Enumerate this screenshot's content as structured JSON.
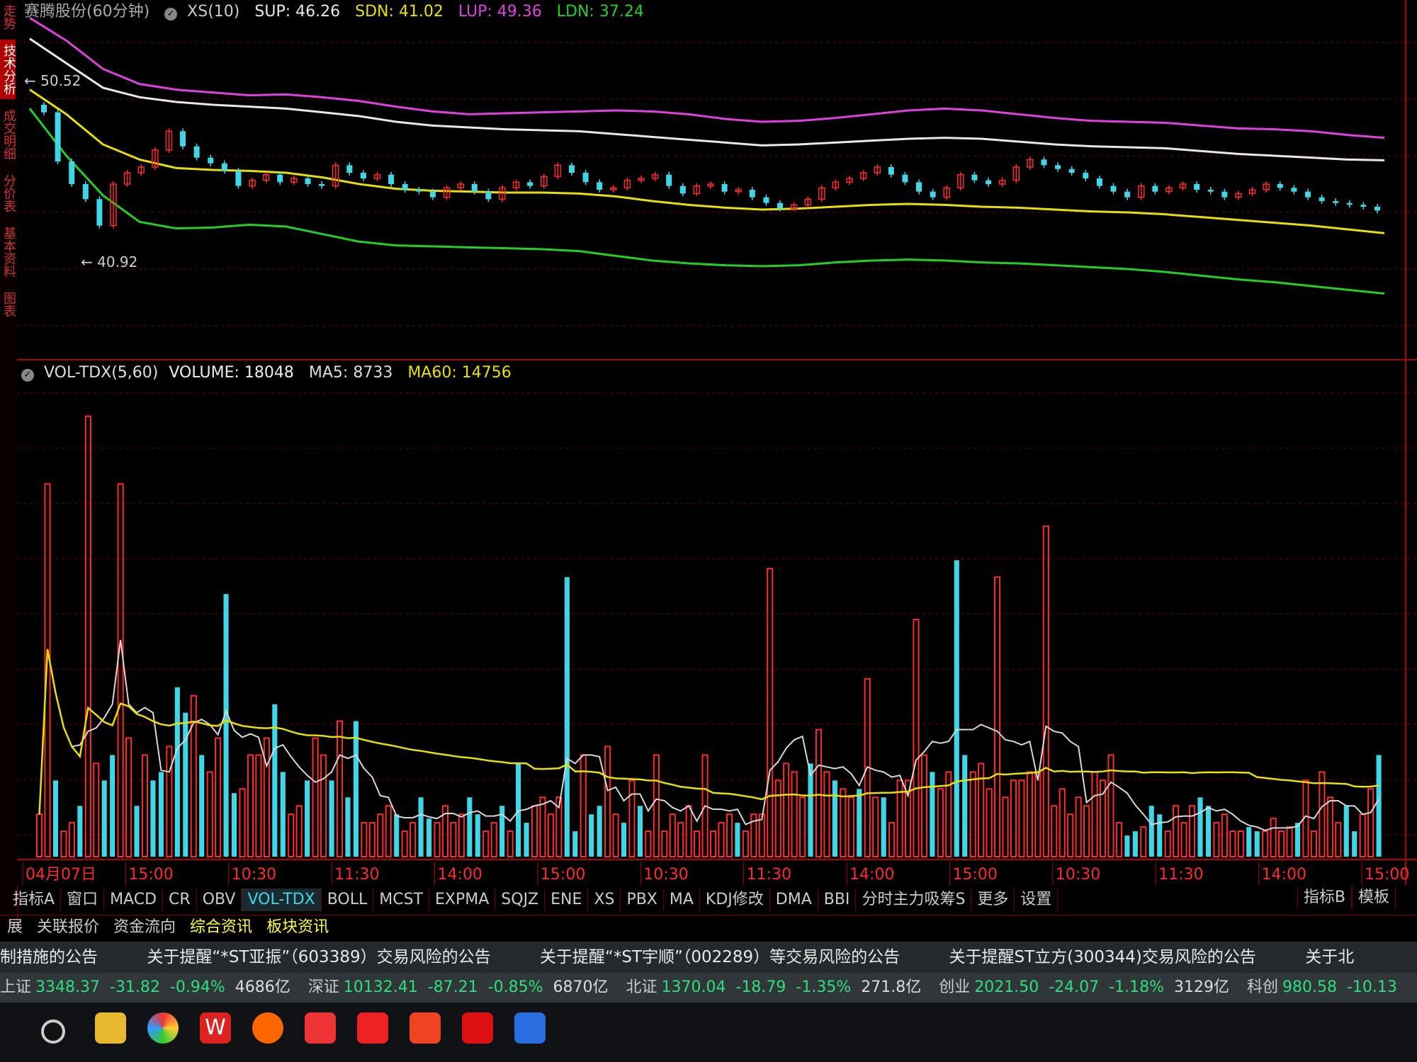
{
  "sidebar": {
    "items": [
      "走势",
      "技术分析",
      "成交明细",
      "分价表",
      "基本资料",
      "图表"
    ]
  },
  "main_legend": {
    "stock": "赛腾股份(60分钟)",
    "indicator": "XS(10)",
    "sup": "SUP: 46.26",
    "sdn": "SDN: 41.02",
    "lup": "LUP: 49.36",
    "ldn": "LDN: 37.24"
  },
  "price_labels": {
    "high": "50.52",
    "low": "40.92"
  },
  "volume_legend": {
    "name": "VOL-TDX(5,60)",
    "volume": "VOLUME: 18048",
    "ma5": "MA5: 8733",
    "ma60": "MA60: 14756"
  },
  "time_axis": [
    "04月07日",
    "15:00",
    "10:30",
    "11:30",
    "14:00",
    "15:00",
    "10:30",
    "11:30",
    "14:00",
    "15:00",
    "10:30",
    "11:30",
    "14:00",
    "15:00"
  ],
  "indicator_tabs": [
    "指标A",
    "窗口",
    "MACD",
    "CR",
    "OBV",
    "VOL-TDX",
    "BOLL",
    "MCST",
    "EXPMA",
    "SQJZ",
    "ENE",
    "XS",
    "PBX",
    "MA",
    "KDJ修改",
    "DMA",
    "BBI",
    "分时主力吸筹S",
    "更多",
    "设置"
  ],
  "right_tabs": [
    "指标B",
    "模板"
  ],
  "info_tabs": [
    "展",
    "关联报价",
    "资金流向",
    "综合资讯",
    "板块资讯"
  ],
  "news": [
    "制措施的公告",
    "关于提醒“*ST亚振”（603389）交易风险的公告",
    "关于提醒“*ST宇顺”（002289）等交易风险的公告",
    "关于提醒ST立方(300344)交易风险的公告",
    "关于北"
  ],
  "indices": [
    {
      "name": "上证",
      "value": "3348.37",
      "change": "-31.82",
      "pct": "-0.94%",
      "amount": "4686亿"
    },
    {
      "name": "深证",
      "value": "10132.41",
      "change": "-87.21",
      "pct": "-0.85%",
      "amount": "6870亿"
    },
    {
      "name": "北证",
      "value": "1370.04",
      "change": "-18.79",
      "pct": "-1.35%",
      "amount": "271.8亿"
    },
    {
      "name": "创业",
      "value": "2021.50",
      "change": "-24.07",
      "pct": "-1.18%",
      "amount": "3129亿"
    },
    {
      "name": "科创",
      "value": "980.58",
      "change": "-10.13",
      "pct": "",
      "amount": ""
    }
  ],
  "colors": {
    "up": "#ff2a2a",
    "down": "#3fd7e8",
    "lup": "#e040e0",
    "sup": "#e8e8e8",
    "sdn": "#e8e000",
    "ldn": "#22d022",
    "ma5": "#d8d8d8",
    "ma60": "#e8e000",
    "grid": "#7a0000"
  },
  "chart_data": [
    {
      "type": "candlestick",
      "title": "赛腾股份(60分钟)",
      "ylim": [
        36,
        54
      ],
      "series": [
        {
          "name": "LUP",
          "values": [
            53.8,
            52.6,
            51.1,
            50.3,
            50.0,
            49.85,
            49.7,
            49.75,
            49.6,
            49.4,
            49.1,
            48.85,
            48.7,
            48.75,
            48.8,
            48.85,
            48.9,
            48.85,
            48.7,
            48.45,
            48.3,
            48.35,
            48.5,
            48.7,
            48.9,
            49.0,
            48.9,
            48.7,
            48.5,
            48.35,
            48.3,
            48.25,
            48.1,
            47.95,
            47.9,
            47.8,
            47.6,
            47.45
          ]
        },
        {
          "name": "SUP",
          "values": [
            52.7,
            51.4,
            50.1,
            49.6,
            49.35,
            49.2,
            49.1,
            49.0,
            48.8,
            48.6,
            48.3,
            48.1,
            48.0,
            47.9,
            47.85,
            47.8,
            47.65,
            47.5,
            47.35,
            47.2,
            47.05,
            47.1,
            47.2,
            47.3,
            47.4,
            47.45,
            47.4,
            47.25,
            47.1,
            47.0,
            46.95,
            46.9,
            46.75,
            46.6,
            46.5,
            46.4,
            46.3,
            46.26
          ]
        },
        {
          "name": "SDN",
          "values": [
            50.0,
            48.7,
            47.1,
            46.3,
            45.85,
            45.75,
            45.7,
            45.6,
            45.35,
            45.0,
            44.75,
            44.65,
            44.6,
            44.55,
            44.55,
            44.5,
            44.35,
            44.1,
            43.9,
            43.75,
            43.65,
            43.7,
            43.8,
            43.9,
            43.95,
            43.9,
            43.8,
            43.75,
            43.65,
            43.55,
            43.5,
            43.4,
            43.25,
            43.1,
            42.95,
            42.8,
            42.6,
            42.4
          ]
        },
        {
          "name": "LDN",
          "values": [
            49.0,
            46.5,
            44.4,
            43.0,
            42.65,
            42.7,
            42.85,
            42.75,
            42.35,
            41.95,
            41.75,
            41.7,
            41.65,
            41.6,
            41.55,
            41.45,
            41.2,
            40.95,
            40.8,
            40.7,
            40.65,
            40.7,
            40.85,
            40.95,
            41.0,
            40.95,
            40.85,
            40.8,
            40.7,
            40.6,
            40.5,
            40.35,
            40.15,
            39.95,
            39.8,
            39.6,
            39.4,
            39.2
          ]
        }
      ],
      "closes": [
        48.8,
        46.2,
        45.0,
        44.2,
        42.8,
        45.0,
        45.6,
        45.9,
        46.8,
        47.8,
        47.0,
        46.4,
        46.1,
        45.7,
        44.9,
        45.2,
        45.5,
        45.1,
        45.3,
        45.0,
        44.9,
        46.0,
        45.6,
        45.3,
        45.5,
        45.0,
        44.7,
        44.6,
        44.3,
        44.8,
        45.0,
        44.6,
        44.2,
        44.8,
        45.1,
        44.9,
        45.4,
        46.0,
        45.6,
        45.1,
        44.7,
        44.8,
        45.2,
        45.3,
        45.5,
        44.9,
        44.5,
        44.9,
        45.0,
        44.6,
        44.7,
        44.3,
        44.0,
        43.7,
        43.9,
        44.2,
        44.8,
        45.1,
        45.3,
        45.6,
        45.9,
        45.5,
        45.1,
        44.6,
        44.3,
        44.8,
        45.5,
        45.2,
        45.0,
        45.2,
        45.9,
        46.3,
        46.0,
        45.8,
        45.6,
        45.3,
        44.9,
        44.6,
        44.3,
        44.9,
        44.6,
        44.8,
        45.0,
        44.7,
        44.6,
        44.3,
        44.5,
        44.7,
        45.0,
        44.8,
        44.6,
        44.3,
        44.1,
        44.0,
        43.9,
        43.8,
        43.6
      ]
    },
    {
      "type": "bar",
      "title": "VOL-TDX(5,60)",
      "series_names": [
        "VOLUME",
        "MA5",
        "MA60"
      ],
      "ylim": [
        0,
        56000
      ],
      "volumes": [
        5000,
        44000,
        9000,
        3000,
        4000,
        6000,
        52000,
        11000,
        9000,
        12000,
        44000,
        14000,
        6000,
        12000,
        9000,
        10000,
        13000,
        20000,
        17000,
        19000,
        12000,
        10000,
        14000,
        31000,
        7500,
        8000,
        12000,
        12000,
        14000,
        18000,
        10000,
        5000,
        6000,
        9000,
        14000,
        12000,
        9000,
        16000,
        7000,
        16000,
        4000,
        4000,
        5000,
        6000,
        5000,
        3000,
        4000,
        7000,
        4500,
        4000,
        6000,
        4000,
        5000,
        7000,
        5000,
        3000,
        4000,
        6000,
        3000,
        11000,
        4000,
        6000,
        7000,
        5000,
        7000,
        33000,
        3000,
        12000,
        5000,
        6000,
        13000,
        5000,
        4000,
        9000,
        6000,
        3000,
        12000,
        3000,
        5000,
        4000,
        6000,
        3000,
        12000,
        3000,
        4000,
        5000,
        4000,
        3000,
        5000,
        5000,
        34000,
        9000,
        11000,
        10000,
        7000,
        11000,
        15000,
        10000,
        9000,
        8000,
        7000,
        8000,
        21000,
        7000,
        7000,
        4000,
        9000,
        9000,
        28000,
        12000,
        10000,
        8000,
        10000,
        35000,
        12000,
        10000,
        11000,
        8000,
        33000,
        7000,
        9000,
        9000,
        10000,
        10000,
        39000,
        6000,
        8000,
        5000,
        7000,
        6000,
        10000,
        9000,
        12000,
        4000,
        2500,
        3000,
        3500,
        6000,
        5000,
        3000,
        6000,
        4000,
        6000,
        7000,
        6000,
        4000,
        5000,
        3000,
        3000,
        3500,
        3000,
        3000,
        4500,
        3000,
        3500,
        4000,
        9000,
        3000,
        10000,
        7000,
        4000,
        6000,
        3000,
        5000,
        8000,
        12000
      ]
    }
  ]
}
